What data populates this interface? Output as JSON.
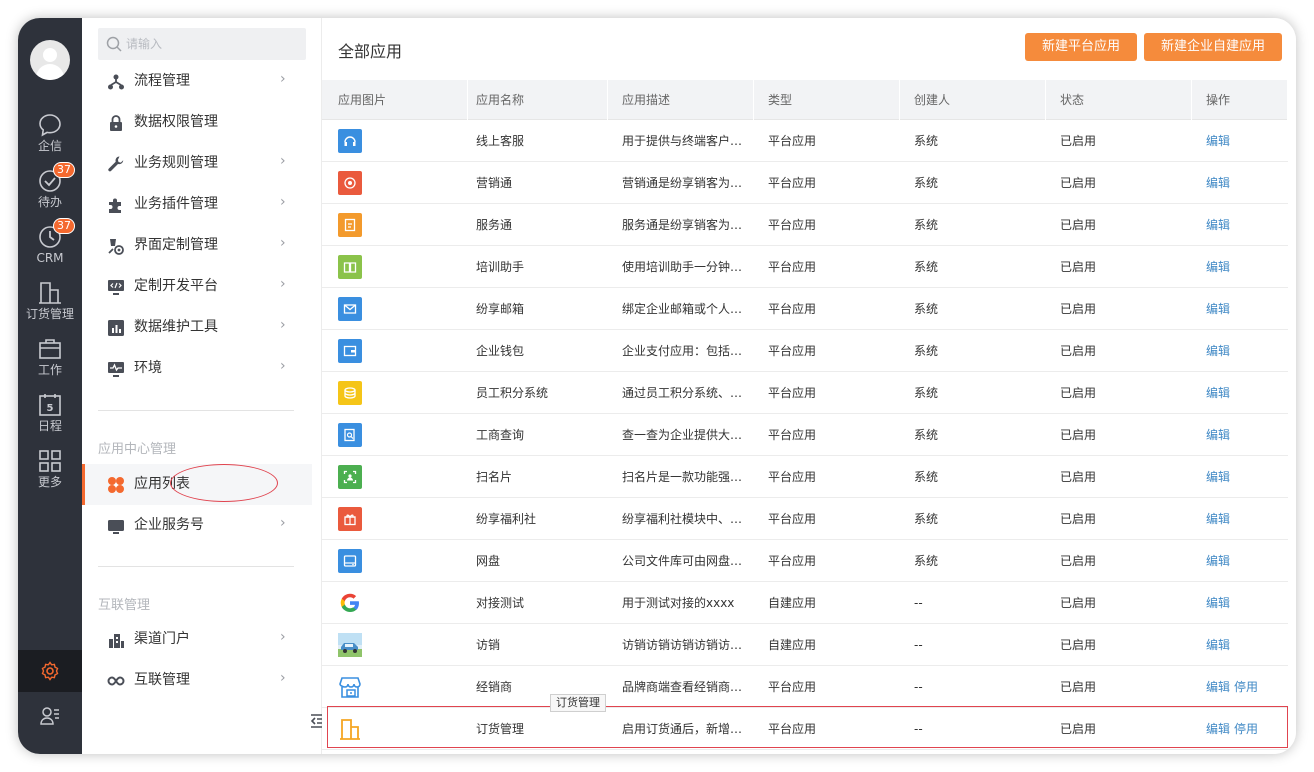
{
  "rail": {
    "items": [
      {
        "label": "企信",
        "icon": "chat-icon",
        "badge": ""
      },
      {
        "label": "待办",
        "icon": "check-circle-icon",
        "badge": "37"
      },
      {
        "label": "CRM",
        "icon": "clock-icon",
        "badge": "37"
      },
      {
        "label": "订货管理",
        "icon": "building-icon",
        "badge": ""
      },
      {
        "label": "工作",
        "icon": "briefcase-icon",
        "badge": ""
      },
      {
        "label": "日程",
        "icon": "calendar-icon",
        "badge": "",
        "day": "5"
      },
      {
        "label": "更多",
        "icon": "grid-icon",
        "badge": ""
      }
    ]
  },
  "sidebar": {
    "search_placeholder": "请输入",
    "items": [
      {
        "label": "流程管理",
        "icon": "flow-icon",
        "arrow": "›"
      },
      {
        "label": "数据权限管理",
        "icon": "lock-icon",
        "arrow": ""
      },
      {
        "label": "业务规则管理",
        "icon": "wrench-icon",
        "arrow": "›"
      },
      {
        "label": "业务插件管理",
        "icon": "puzzle-icon",
        "arrow": "›"
      },
      {
        "label": "界面定制管理",
        "icon": "paint-icon",
        "arrow": "›"
      },
      {
        "label": "定制开发平台",
        "icon": "code-monitor-icon",
        "arrow": "›"
      },
      {
        "label": "数据维护工具",
        "icon": "bar-chart-icon",
        "arrow": "›"
      },
      {
        "label": "环境",
        "icon": "monitor-pulse-icon",
        "arrow": "›"
      }
    ],
    "group_app_center": "应用中心管理",
    "app_items": [
      {
        "label": "应用列表",
        "icon": "app-grid-icon",
        "arrow": ""
      },
      {
        "label": "企业服务号",
        "icon": "service-monitor-icon",
        "arrow": "›"
      }
    ],
    "group_interconnect": "互联管理",
    "inter_items": [
      {
        "label": "渠道门户",
        "icon": "portal-icon",
        "arrow": "›"
      },
      {
        "label": "互联管理",
        "icon": "link-icon",
        "arrow": "›"
      }
    ]
  },
  "main": {
    "title": "全部应用",
    "btn_new_platform": "新建平台应用",
    "btn_new_enterprise": "新建企业自建应用",
    "columns": [
      "应用图片",
      "应用名称",
      "应用描述",
      "类型",
      "创建人",
      "状态",
      "操作"
    ],
    "rows": [
      {
        "name": "线上客服",
        "desc": "用于提供与终端客户…",
        "type": "平台应用",
        "creator": "系统",
        "status": "已启用",
        "edit": "编辑",
        "disable": "",
        "icon": "headset-icon",
        "color": "#3a8fe0"
      },
      {
        "name": "营销通",
        "desc": "营销通是纷享销客为…",
        "type": "平台应用",
        "creator": "系统",
        "status": "已启用",
        "edit": "编辑",
        "disable": "",
        "icon": "target-icon",
        "color": "#ea5a3d"
      },
      {
        "name": "服务通",
        "desc": "服务通是纷享销客为…",
        "type": "平台应用",
        "creator": "系统",
        "status": "已启用",
        "edit": "编辑",
        "disable": "",
        "icon": "service-doc-icon",
        "color": "#f39a2c"
      },
      {
        "name": "培训助手",
        "desc": "使用培训助手一分钟…",
        "type": "平台应用",
        "creator": "系统",
        "status": "已启用",
        "edit": "编辑",
        "disable": "",
        "icon": "book-icon",
        "color": "#8bc34a"
      },
      {
        "name": "纷享邮箱",
        "desc": "绑定企业邮箱或个人…",
        "type": "平台应用",
        "creator": "系统",
        "status": "已启用",
        "edit": "编辑",
        "disable": "",
        "icon": "mail-icon",
        "color": "#3a8fe0"
      },
      {
        "name": "企业钱包",
        "desc": "企业支付应用：包括…",
        "type": "平台应用",
        "creator": "系统",
        "status": "已启用",
        "edit": "编辑",
        "disable": "",
        "icon": "wallet-icon",
        "color": "#3a8fe0"
      },
      {
        "name": "员工积分系统",
        "desc": "通过员工积分系统、…",
        "type": "平台应用",
        "creator": "系统",
        "status": "已启用",
        "edit": "编辑",
        "disable": "",
        "icon": "coins-icon",
        "color": "#f5c518"
      },
      {
        "name": "工商查询",
        "desc": "查一查为企业提供大…",
        "type": "平台应用",
        "creator": "系统",
        "status": "已启用",
        "edit": "编辑",
        "disable": "",
        "icon": "search-doc-icon",
        "color": "#3a8fe0"
      },
      {
        "name": "扫名片",
        "desc": "扫名片是一款功能强…",
        "type": "平台应用",
        "creator": "系统",
        "status": "已启用",
        "edit": "编辑",
        "disable": "",
        "icon": "scan-card-icon",
        "color": "#4caf50"
      },
      {
        "name": "纷享福利社",
        "desc": "纷享福利社模块中、…",
        "type": "平台应用",
        "creator": "系统",
        "status": "已启用",
        "edit": "编辑",
        "disable": "",
        "icon": "gift-icon",
        "color": "#ea5a3d"
      },
      {
        "name": "网盘",
        "desc": "公司文件库可由网盘…",
        "type": "平台应用",
        "creator": "系统",
        "status": "已启用",
        "edit": "编辑",
        "disable": "",
        "icon": "drive-icon",
        "color": "#3a8fe0"
      },
      {
        "name": "对接测试",
        "desc": "用于测试对接的xxxx",
        "type": "自建应用",
        "creator": "--",
        "status": "已启用",
        "edit": "编辑",
        "disable": "",
        "icon": "google-g-icon",
        "color": "#4285f4"
      },
      {
        "name": "访销",
        "desc": "访销访销访销访销访…",
        "type": "自建应用",
        "creator": "--",
        "status": "已启用",
        "edit": "编辑",
        "disable": "",
        "icon": "car-photo-icon",
        "color": "#7bb6e0"
      },
      {
        "name": "经销商",
        "desc": "品牌商端查看经销商…",
        "type": "平台应用",
        "creator": "--",
        "status": "已启用",
        "edit": "编辑",
        "disable": "停用",
        "icon": "store-icon",
        "color": "#3a8fe0"
      },
      {
        "name": "订货管理",
        "desc": "启用订货通后，新增…",
        "type": "平台应用",
        "creator": "--",
        "status": "已启用",
        "edit": "编辑",
        "disable": "停用",
        "icon": "building-icon",
        "color": "#f5a623"
      }
    ],
    "tooltip": "订货管理"
  }
}
